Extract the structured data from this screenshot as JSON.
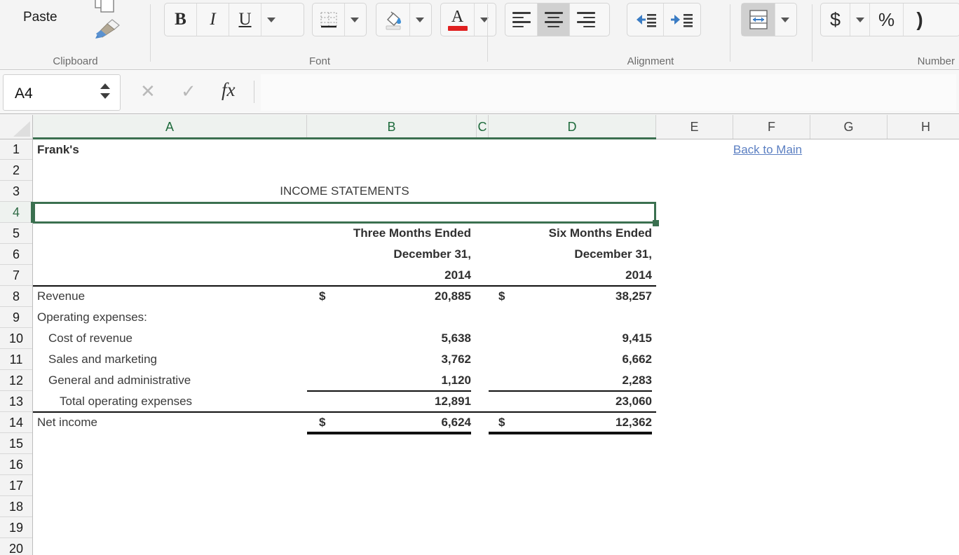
{
  "ribbon": {
    "groups": [
      {
        "name": "clipboard",
        "label": "Clipboard"
      },
      {
        "name": "font",
        "label": "Font"
      },
      {
        "name": "alignment",
        "label": "Alignment"
      },
      {
        "name": "number",
        "label": "Number"
      }
    ],
    "clipboard": {
      "paste_label": "Paste",
      "icons": [
        "clipboard-icon",
        "format-painter-icon"
      ]
    },
    "font": {
      "bold": "B",
      "italic": "I",
      "underline": "U",
      "border_icon": "bottom-border-icon",
      "fill_color_icon": "fill-color-icon",
      "font_color_icon": "font-color-icon",
      "font_color_swatch": "#e02020",
      "fill_color_swatch": "#e8e8e8"
    },
    "alignment": {
      "align_left": "align-left-icon",
      "align_center": "align-center-icon",
      "align_right": "align-right-icon",
      "decrease_indent": "decrease-indent-icon",
      "increase_indent": "increase-indent-icon",
      "wrap_text": "wrap-text-icon",
      "active": "align-center"
    },
    "number": {
      "currency": "$",
      "percent": "%",
      "comma": ")"
    }
  },
  "formula_bar": {
    "name_box_value": "A4",
    "cancel": "✕",
    "enter": "✓",
    "fx": "fx",
    "formula_value": ""
  },
  "grid": {
    "columns": [
      {
        "label": "A",
        "selected": true
      },
      {
        "label": "B",
        "selected": true
      },
      {
        "label": "C",
        "selected": true
      },
      {
        "label": "D",
        "selected": true
      },
      {
        "label": "E",
        "selected": false
      },
      {
        "label": "F",
        "selected": false
      },
      {
        "label": "G",
        "selected": false
      },
      {
        "label": "H",
        "selected": false
      }
    ],
    "rows": [
      {
        "num": "1",
        "selected": false
      },
      {
        "num": "2",
        "selected": false
      },
      {
        "num": "3",
        "selected": false
      },
      {
        "num": "4",
        "selected": true
      },
      {
        "num": "5",
        "selected": false
      },
      {
        "num": "6",
        "selected": false
      },
      {
        "num": "7",
        "selected": false
      },
      {
        "num": "8",
        "selected": false
      },
      {
        "num": "9",
        "selected": false
      },
      {
        "num": "10",
        "selected": false
      },
      {
        "num": "11",
        "selected": false
      },
      {
        "num": "12",
        "selected": false
      },
      {
        "num": "13",
        "selected": false
      },
      {
        "num": "14",
        "selected": false
      },
      {
        "num": "15",
        "selected": false
      },
      {
        "num": "16",
        "selected": false
      },
      {
        "num": "17",
        "selected": false
      },
      {
        "num": "18",
        "selected": false
      },
      {
        "num": "19",
        "selected": false
      },
      {
        "num": "20",
        "selected": false
      }
    ],
    "selected_cell": "A4",
    "accent_color": "#3b7050",
    "link_color": "#5b7fc2"
  },
  "sheet": {
    "company": "Frank's",
    "back_link": "Back to Main",
    "title": "INCOME STATEMENTS",
    "headers": {
      "three_months_l1": "Three Months Ended",
      "three_months_l2": "December 31,",
      "three_months_l3": "2014",
      "six_months_l1": "Six Months Ended",
      "six_months_l2": "December 31,",
      "six_months_l3": "2014"
    },
    "currency_symbol": "$",
    "lines": [
      {
        "label": "Revenue",
        "three": "20,885",
        "six": "38,257"
      },
      {
        "label": "Operating expenses:",
        "three": "",
        "six": ""
      },
      {
        "label": "Cost of revenue",
        "three": "5,638",
        "six": "9,415"
      },
      {
        "label": "Sales and marketing",
        "three": "3,762",
        "six": "6,662"
      },
      {
        "label": "General and administrative",
        "three": "1,120",
        "six": "2,283"
      },
      {
        "label": "Total operating expenses",
        "three": "12,891",
        "six": "23,060"
      },
      {
        "label": "Net income",
        "three": "6,624",
        "six": "12,362"
      }
    ]
  }
}
